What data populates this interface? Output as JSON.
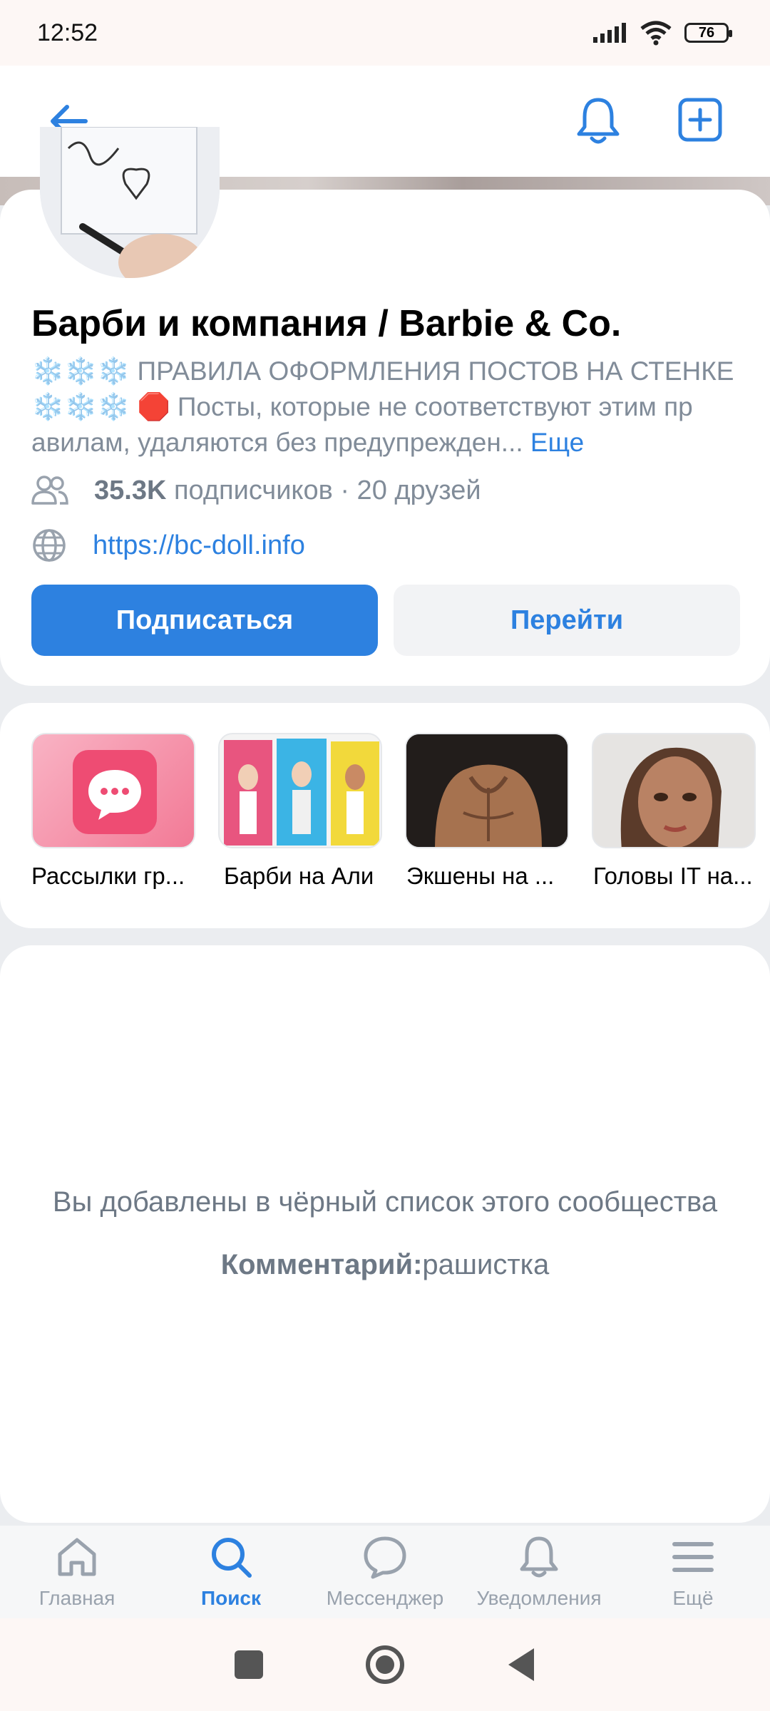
{
  "status_bar": {
    "time": "12:52",
    "battery": "76"
  },
  "header": {
    "back_icon": "arrow-left-icon",
    "bell_icon": "bell-icon",
    "add_icon": "plus-square-icon"
  },
  "group": {
    "name": "Барби и компания / Barbie & Co.",
    "description_prefix": "❄️❄️❄️ ПРАВИЛА ОФОРМЛЕНИЯ ПОСТОВ НА СТЕНКЕ ❄️❄️❄️ 🛑 Посты, которые не соответствуют этим пр авилам, удаляются без предупрежден... ",
    "more_label": "Еще",
    "subscribers_count": "35.3K",
    "subscribers_rest": " подписчиков · 20 друзей",
    "website": "https://bc-doll.info",
    "subscribe_label": "Подписаться",
    "goto_label": "Перейти"
  },
  "tiles": [
    {
      "label": "Рассылки гр..."
    },
    {
      "label": "Барби на Али"
    },
    {
      "label": "Экшены на ..."
    },
    {
      "label": "Головы IT на..."
    }
  ],
  "blocked": {
    "message": "Вы добавлены в чёрный список этого сообщества",
    "comment_label": "Комментарий:",
    "comment_value": "рашистка"
  },
  "tabbar": [
    {
      "label": "Главная",
      "icon": "home-icon"
    },
    {
      "label": "Поиск",
      "icon": "search-icon",
      "active": true
    },
    {
      "label": "Мессенджер",
      "icon": "chat-icon"
    },
    {
      "label": "Уведомления",
      "icon": "bell-icon"
    },
    {
      "label": "Ещё",
      "icon": "menu-icon"
    }
  ],
  "colors": {
    "accent": "#2d81e0",
    "background": "#ebedf0",
    "secondary_text": "#818c99"
  }
}
